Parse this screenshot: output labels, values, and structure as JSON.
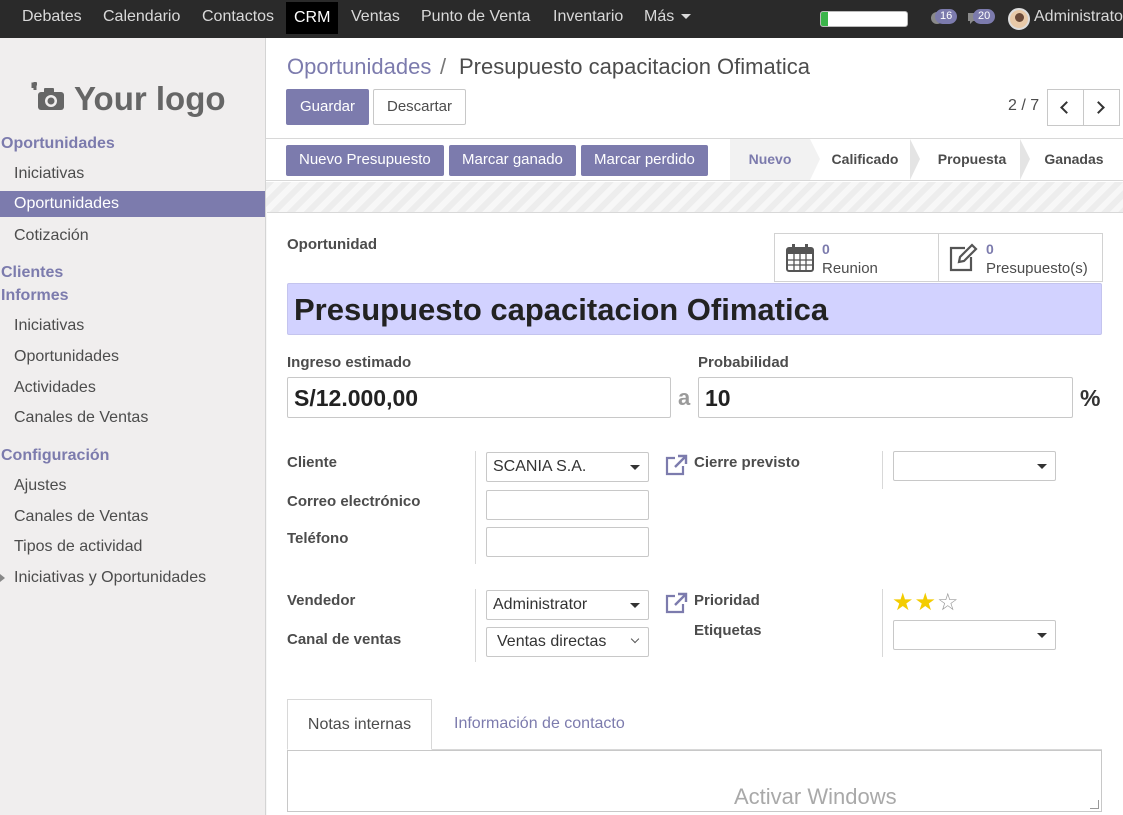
{
  "topnav": {
    "menus": [
      "Debates",
      "Calendario",
      "Contactos",
      "CRM",
      "Ventas",
      "Punto de Venta",
      "Inventario",
      "Más"
    ],
    "active_menu": "CRM",
    "progress_fraction": 0.08,
    "activities_count": "16",
    "messages_count": "20",
    "user_name": "Administrator"
  },
  "sidebar": {
    "logo_text": "Your logo",
    "sections": [
      {
        "label": "Oportunidades",
        "items": [
          "Iniciativas",
          "Oportunidades",
          "Cotización"
        ]
      },
      {
        "label": "Clientes",
        "items": []
      },
      {
        "label": "Informes",
        "items": [
          "Iniciativas",
          "Oportunidades",
          "Actividades",
          "Canales de Ventas"
        ]
      },
      {
        "label": "Configuración",
        "items": [
          "Ajustes",
          "Canales de Ventas",
          "Tipos de actividad",
          "Iniciativas y Oportunidades"
        ]
      }
    ],
    "active_item": "Oportunidades"
  },
  "breadcrumb": {
    "parent": "Oportunidades",
    "separator": "/",
    "current": "Presupuesto capacitacion Ofimatica"
  },
  "actions": {
    "save": "Guardar",
    "discard": "Descartar"
  },
  "pager": {
    "value": "2 / 7"
  },
  "statusbar": {
    "buttons": [
      "Nuevo Presupuesto",
      "Marcar ganado",
      "Marcar perdido"
    ],
    "stages": [
      "Nuevo",
      "Calificado",
      "Propuesta",
      "Ganadas"
    ],
    "current_stage": "Nuevo"
  },
  "form": {
    "name_label": "Oportunidad",
    "name": "Presupuesto capacitacion Ofimatica",
    "smart_buttons": [
      {
        "count": "0",
        "label": "Reunion",
        "icon": "calendar-icon"
      },
      {
        "count": "0",
        "label": "Presupuesto(s)",
        "icon": "edit-icon"
      }
    ],
    "revenue_label": "Ingreso estimado",
    "revenue": "S/12.000,00",
    "at_label": "a",
    "probability_label": "Probabilidad",
    "probability": "10",
    "percent_sign": "%",
    "customer_label": "Cliente",
    "customer": "SCANIA S.A.",
    "email_label": "Correo electrónico",
    "email": "",
    "phone_label": "Teléfono",
    "phone": "",
    "deadline_label": "Cierre previsto",
    "deadline": "",
    "salesperson_label": "Vendedor",
    "salesperson": "Administrator",
    "channel_label": "Canal de ventas",
    "channel": "Ventas directas",
    "priority_label": "Prioridad",
    "priority_stars": 2,
    "priority_max": 3,
    "tags_label": "Etiquetas",
    "tags": ""
  },
  "tabs": {
    "items": [
      "Notas internas",
      "Información de contacto"
    ],
    "active": "Notas internas"
  },
  "notes": "",
  "watermark": "Activar Windows",
  "colors": {
    "accent": "#7c7bad",
    "topbar": "#2a2a2a",
    "title_bg": "#d2d2ff",
    "star": "#f3cc00",
    "progress": "#3bb54a"
  }
}
